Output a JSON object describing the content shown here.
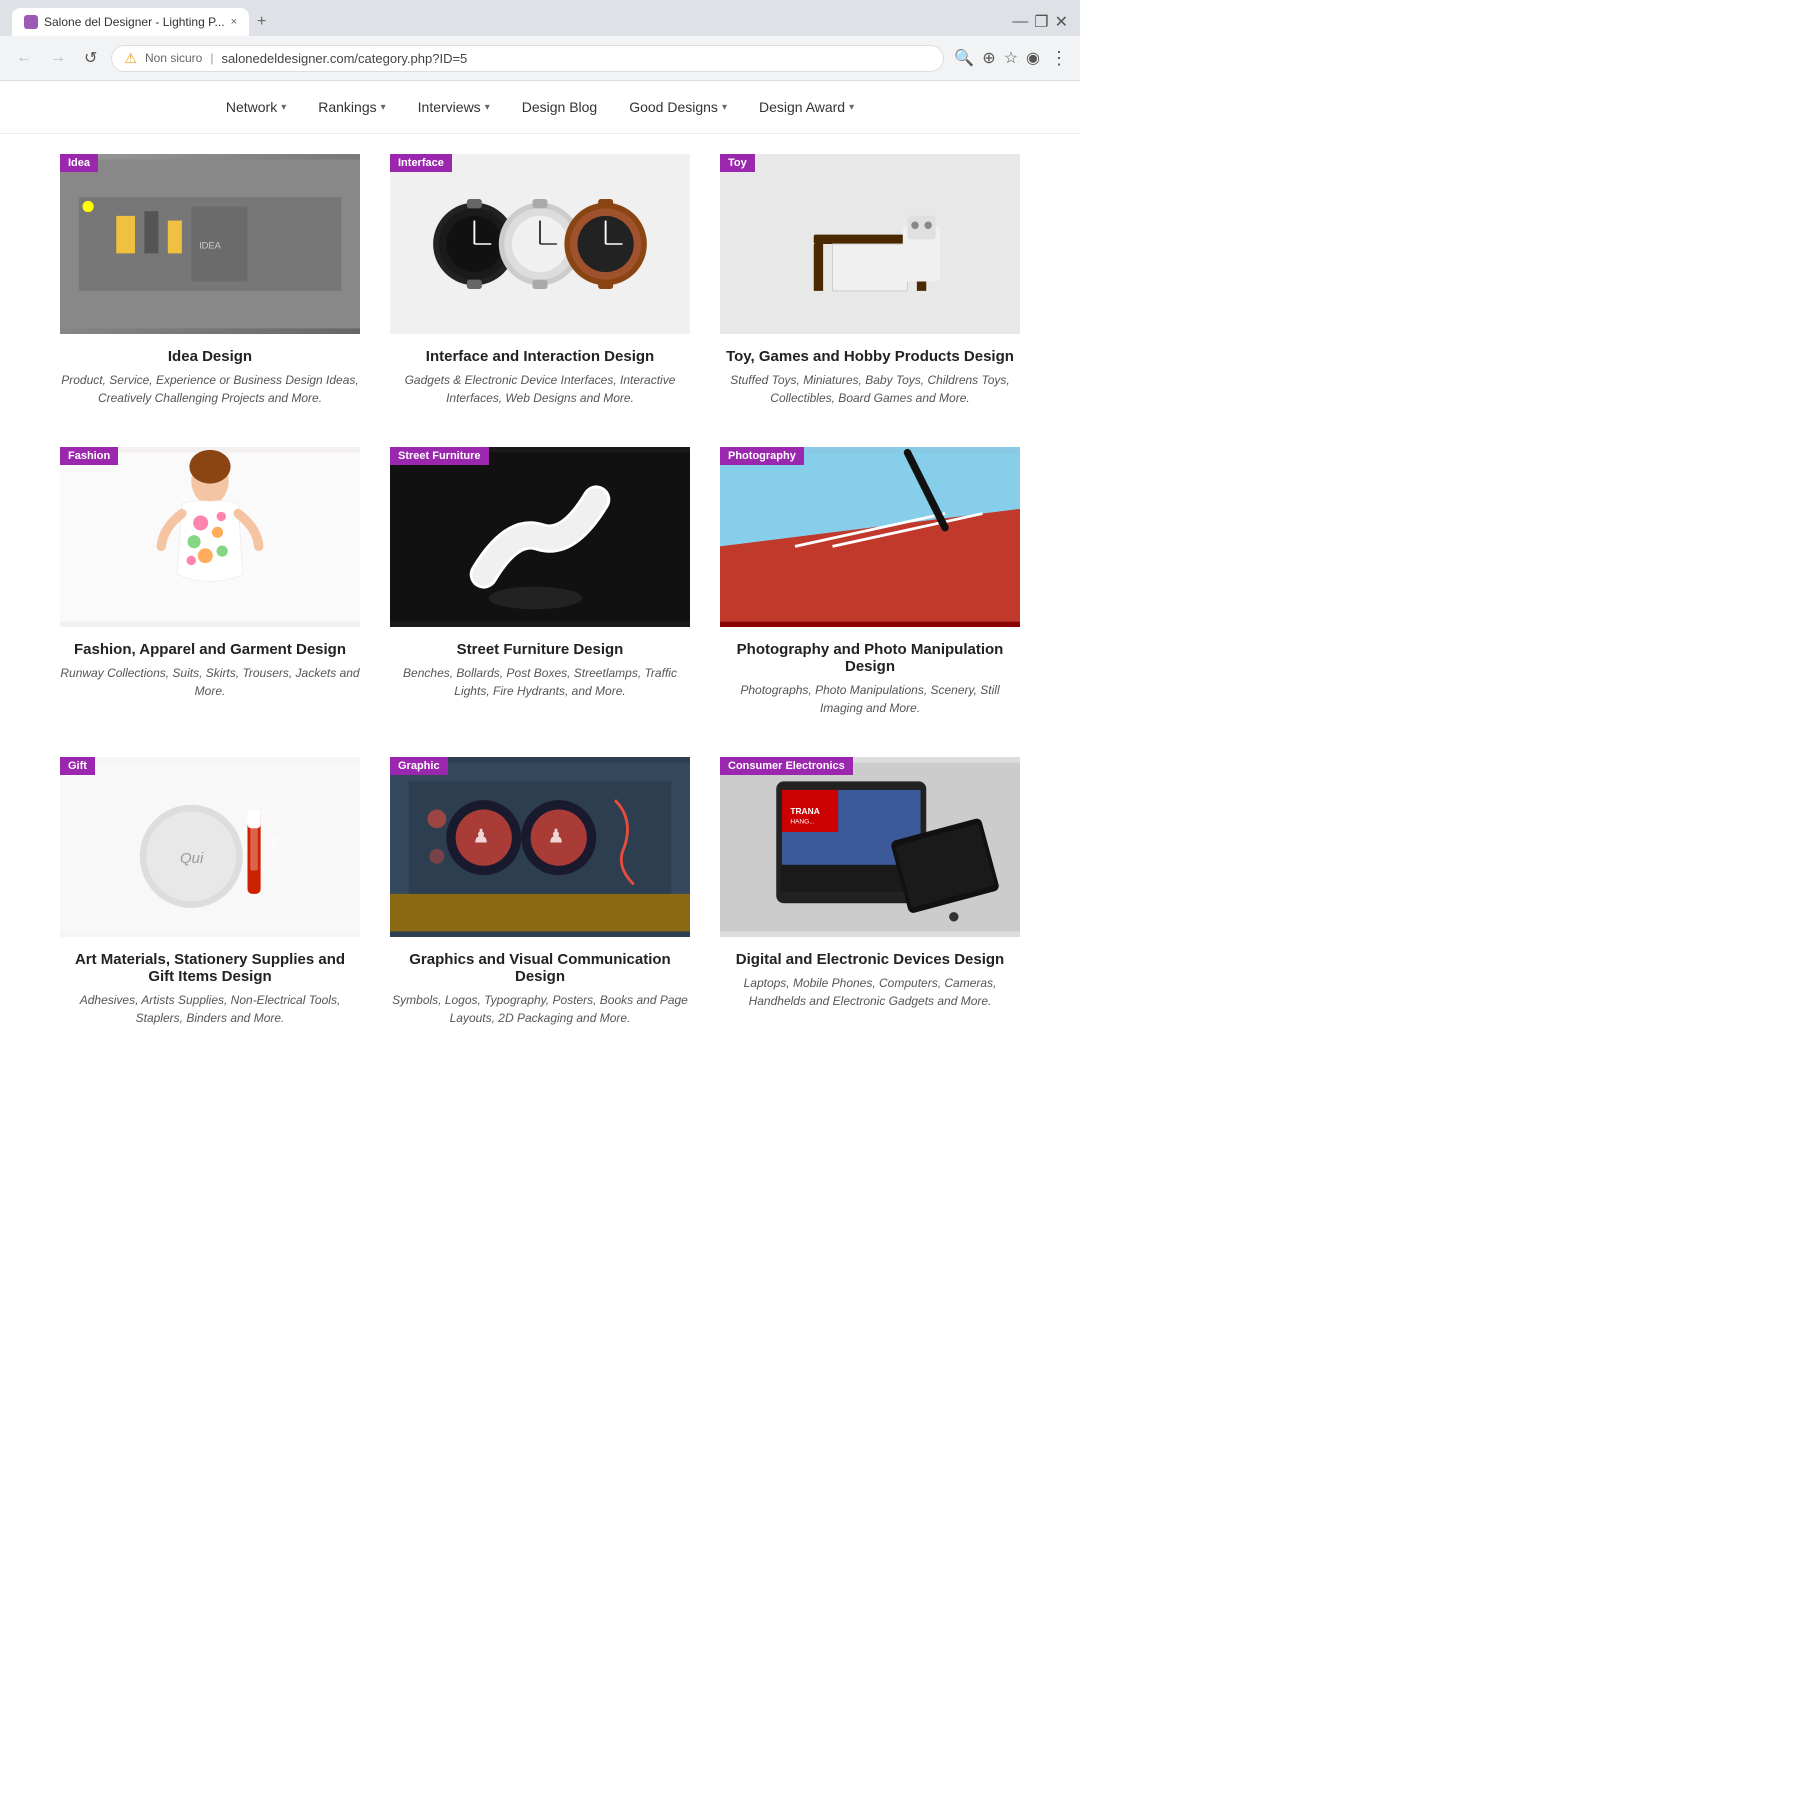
{
  "browser": {
    "tab_title": "Salone del Designer - Lighting P...",
    "tab_close": "×",
    "new_tab": "+",
    "window_minimize": "—",
    "window_restore": "❐",
    "window_close": "✕",
    "nav_back": "←",
    "nav_forward": "→",
    "nav_reload": "↺",
    "warning_label": "Non sicuro",
    "url": "salonedeldesigner.com/category.php?ID=5",
    "address_actions": {
      "zoom": "🔍",
      "share": "⊕",
      "bookmark": "☆",
      "profile": "◉",
      "menu": "⋮"
    }
  },
  "nav": {
    "items": [
      {
        "label": "Network",
        "has_dropdown": true
      },
      {
        "label": "Rankings",
        "has_dropdown": true
      },
      {
        "label": "Interviews",
        "has_dropdown": true
      },
      {
        "label": "Design Blog",
        "has_dropdown": false
      },
      {
        "label": "Good Designs",
        "has_dropdown": true
      },
      {
        "label": "Design Award",
        "has_dropdown": true
      }
    ]
  },
  "cards": [
    {
      "badge": "Idea",
      "title": "Idea Design",
      "desc": "Product, Service, Experience or Business Design Ideas, Creatively Challenging Projects and More.",
      "img_class": "img-idea"
    },
    {
      "badge": "Interface",
      "title": "Interface and Interaction Design",
      "desc": "Gadgets & Electronic Device Interfaces, Interactive Interfaces, Web Designs and More.",
      "img_class": "img-interface"
    },
    {
      "badge": "Toy",
      "title": "Toy, Games and Hobby Products Design",
      "desc": "Stuffed Toys, Miniatures, Baby Toys, Childrens Toys, Collectibles, Board Games and More.",
      "img_class": "img-toy"
    },
    {
      "badge": "Fashion",
      "title": "Fashion, Apparel and Garment Design",
      "desc": "Runway Collections, Suits, Skirts, Trousers, Jackets and More.",
      "img_class": "img-fashion"
    },
    {
      "badge": "Street Furniture",
      "title": "Street Furniture Design",
      "desc": "Benches, Bollards, Post Boxes, Streetlamps, Traffic Lights, Fire Hydrants, and More.",
      "img_class": "img-street"
    },
    {
      "badge": "Photography",
      "title": "Photography and Photo Manipulation Design",
      "desc": "Photographs, Photo Manipulations, Scenery, Still Imaging and More.",
      "img_class": "img-photo"
    },
    {
      "badge": "Gift",
      "title": "Art Materials, Stationery Supplies and Gift Items Design",
      "desc": "Adhesives, Artists Supplies, Non-Electrical Tools, Staplers, Binders and More.",
      "img_class": "img-gift"
    },
    {
      "badge": "Graphic",
      "title": "Graphics and Visual Communication Design",
      "desc": "Symbols, Logos, Typography, Posters, Books and Page Layouts, 2D Packaging and More.",
      "img_class": "img-graphic"
    },
    {
      "badge": "Consumer Electronics",
      "title": "Digital and Electronic Devices Design",
      "desc": "Laptops, Mobile Phones, Computers, Cameras, Handhelds and Electronic Gadgets and More.",
      "img_class": "img-electronics"
    }
  ]
}
